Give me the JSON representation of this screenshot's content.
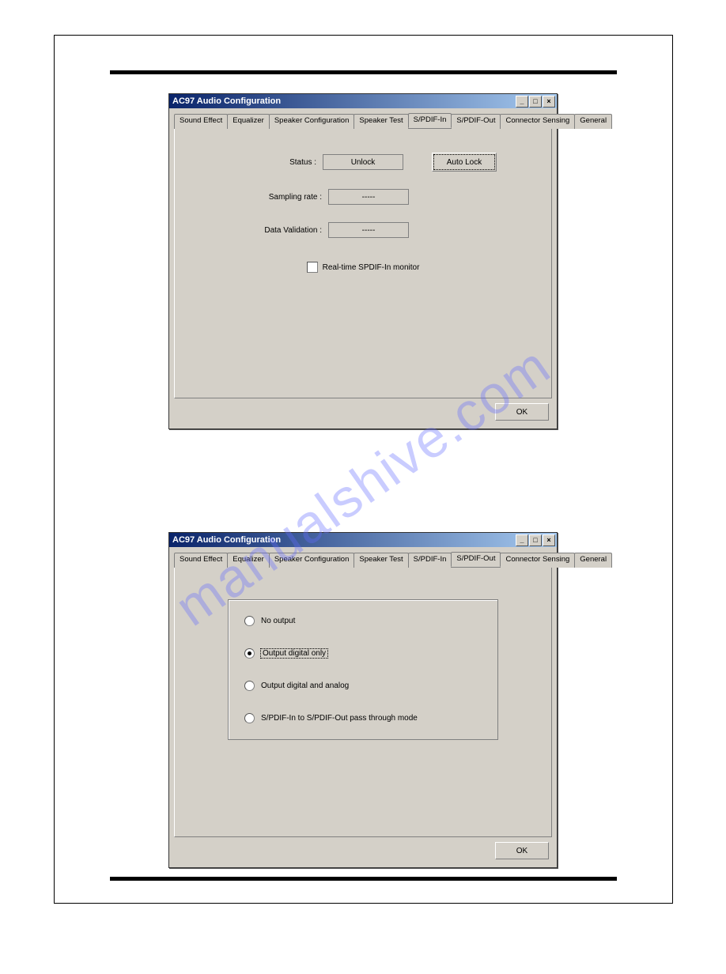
{
  "watermark": "manualshive.com",
  "dialog1": {
    "title": "AC97 Audio Configuration",
    "tabs": [
      "Sound Effect",
      "Equalizer",
      "Speaker Configuration",
      "Speaker Test",
      "S/PDIF-In",
      "S/PDIF-Out",
      "Connector Sensing",
      "General"
    ],
    "active_tab": 4,
    "status_label": "Status :",
    "status_value": "Unlock",
    "autolock_btn": "Auto Lock",
    "sampling_label": "Sampling rate :",
    "sampling_value": "-----",
    "validation_label": "Data Validation :",
    "validation_value": "-----",
    "monitor_label": "Real-time SPDIF-In monitor",
    "ok": "OK"
  },
  "dialog2": {
    "title": "AC97 Audio Configuration",
    "tabs": [
      "Sound Effect",
      "Equalizer",
      "Speaker Configuration",
      "Speaker Test",
      "S/PDIF-In",
      "S/PDIF-Out",
      "Connector Sensing",
      "General"
    ],
    "active_tab": 5,
    "radios": {
      "no_output": "No output",
      "digital_only": "Output digital only",
      "digital_analog": "Output digital and analog",
      "passthrough": "S/PDIF-In to S/PDIF-Out pass through mode"
    },
    "selected_radio": 1,
    "ok": "OK"
  }
}
